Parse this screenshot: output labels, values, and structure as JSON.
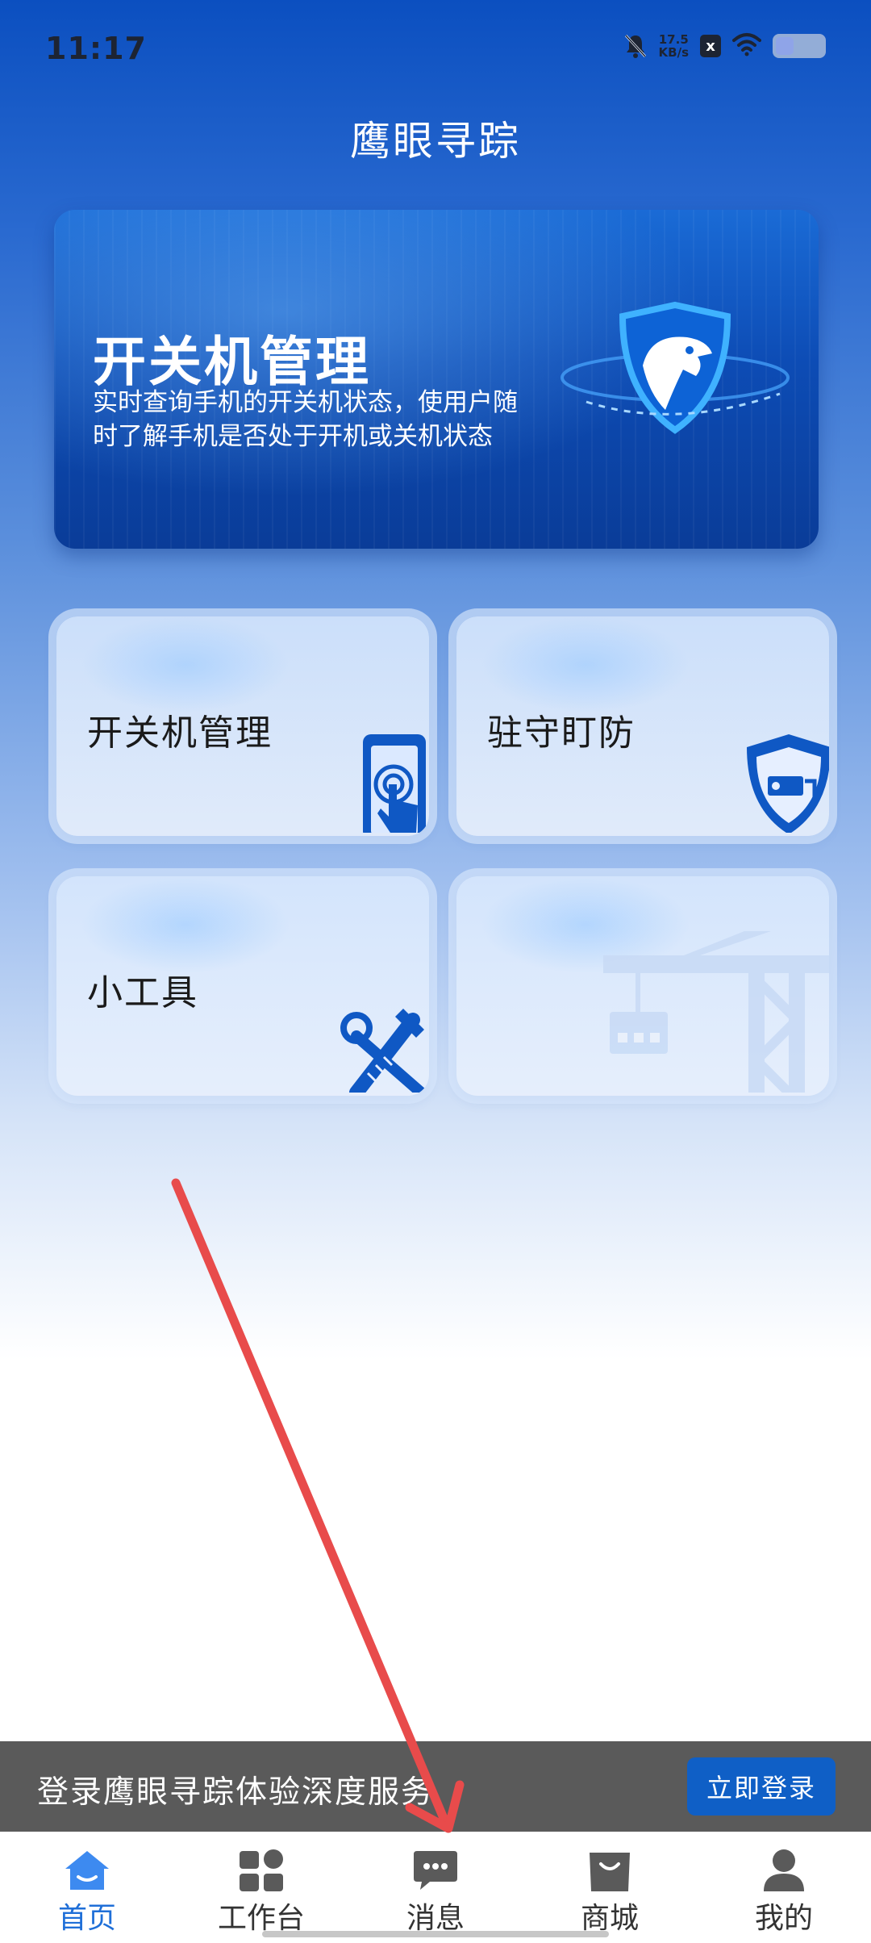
{
  "status_bar": {
    "time": "11:17",
    "net_speed_value": "17.5",
    "net_speed_unit": "KB/s",
    "x_badge": "x"
  },
  "header": {
    "title": "鹰眼寻踪"
  },
  "banner": {
    "title": "开关机管理",
    "description_line1": "实时查询手机的开关机状态，使用户随",
    "description_line2": "时了解手机是否处于开机或关机状态"
  },
  "tiles": [
    {
      "label": "开关机管理",
      "icon": "phone-touch-icon"
    },
    {
      "label": "驻守盯防",
      "icon": "shield-camera-icon"
    },
    {
      "label": "小工具",
      "icon": "tools-icon"
    },
    {
      "label": "",
      "icon": "crane-icon"
    }
  ],
  "login_bar": {
    "text": "登录鹰眼寻踪体验深度服务",
    "button_label": "立即登录"
  },
  "bottom_nav": [
    {
      "label": "首页",
      "icon": "home-icon",
      "active": true
    },
    {
      "label": "工作台",
      "icon": "grid-icon",
      "active": false
    },
    {
      "label": "消息",
      "icon": "message-icon",
      "active": false
    },
    {
      "label": "商城",
      "icon": "shop-bag-icon",
      "active": false
    },
    {
      "label": "我的",
      "icon": "profile-icon",
      "active": false
    }
  ],
  "colors": {
    "brand_blue": "#0f5fc6",
    "nav_active": "#1f6fd8",
    "nav_inactive": "#333333",
    "login_bar_bg": "#5a5a5a",
    "annotation_arrow": "#e84b4b"
  }
}
